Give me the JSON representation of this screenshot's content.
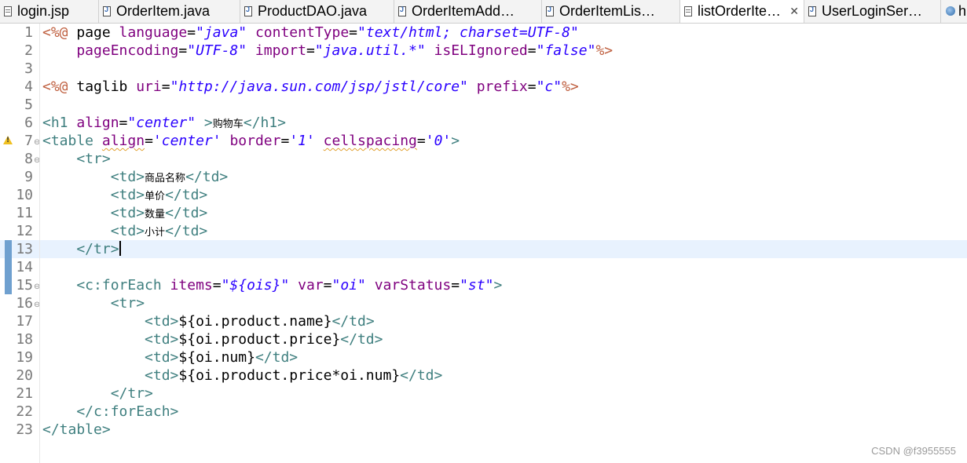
{
  "tabs": [
    {
      "label": "login.jsp",
      "icon": "jsp-file-icon",
      "active": false
    },
    {
      "label": "OrderItem.java",
      "icon": "java-file-icon",
      "active": false
    },
    {
      "label": "ProductDAO.java",
      "icon": "java-file-icon",
      "active": false
    },
    {
      "label": "OrderItemAdd…",
      "icon": "java-file-icon",
      "active": false
    },
    {
      "label": "OrderItemLis…",
      "icon": "java-file-icon",
      "active": false
    },
    {
      "label": "listOrderIte…",
      "icon": "jsp-file-icon",
      "active": true,
      "close": "✕"
    },
    {
      "label": "UserLoginSer…",
      "icon": "java-file-icon",
      "active": false
    },
    {
      "label": "h",
      "icon": "globe-icon",
      "active": false
    }
  ],
  "editor": {
    "line_numbers": [
      "1",
      "2",
      "3",
      "4",
      "5",
      "6",
      "7",
      "8",
      "9",
      "10",
      "11",
      "12",
      "13",
      "14",
      "15",
      "16",
      "17",
      "18",
      "19",
      "20",
      "21",
      "22",
      "23"
    ],
    "code": {
      "l1": {
        "a": "<%@",
        "b": " page ",
        "c": "language",
        "d": "=",
        "e": "\"java\"",
        "f": " contentType",
        "g": "=",
        "h": "\"text/html; charset=UTF-8\""
      },
      "l2": {
        "a": "    pageEncoding",
        "b": "=",
        "c": "\"UTF-8\"",
        "d": " import",
        "e": "=",
        "f": "\"java.util.*\"",
        "g": " isELIgnored",
        "h": "=",
        "i": "\"false\"",
        "j": "%>"
      },
      "l4": {
        "a": "<%@",
        "b": " taglib ",
        "c": "uri",
        "d": "=",
        "e": "\"http://java.sun.com/jsp/jstl/core\"",
        "f": " prefix",
        "g": "=",
        "h": "\"c\"",
        "i": "%>"
      },
      "l6": {
        "a": "<h1",
        "b": " align",
        "c": "=",
        "d": "\"center\"",
        "e": " >",
        "f": "购物车",
        "g": "</h1>"
      },
      "l7": {
        "a": "<table",
        "b": " ",
        "c": "align",
        "d": "=",
        "e": "'center'",
        "f": " border",
        "g": "=",
        "h": "'1'",
        "i": " ",
        "j": "cellspacing",
        "k": "=",
        "l": "'0'",
        "m": ">"
      },
      "l8": {
        "a": "    <tr>"
      },
      "l9": {
        "a": "        <td>",
        "b": "商品名称",
        "c": "</td>"
      },
      "l10": {
        "a": "        <td>",
        "b": "单价",
        "c": "</td>"
      },
      "l11": {
        "a": "        <td>",
        "b": "数量",
        "c": "</td>"
      },
      "l12": {
        "a": "        <td>",
        "b": "小计",
        "c": "</td>"
      },
      "l13": {
        "a": "    </tr>"
      },
      "l15": {
        "a": "    <c:forEach",
        "b": " items",
        "c": "=",
        "d": "\"${ois}\"",
        "e": " var",
        "f": "=",
        "g": "\"oi\"",
        "h": " varStatus",
        "i": "=",
        "j": "\"st\"",
        "k": ">"
      },
      "l16": {
        "a": "        <tr>"
      },
      "l17": {
        "a": "            <td>",
        "b": "${oi.product.name}",
        "c": "</td>"
      },
      "l18": {
        "a": "            <td>",
        "b": "${oi.product.price}",
        "c": "</td>"
      },
      "l19": {
        "a": "            <td>",
        "b": "${oi.num}",
        "c": "</td>"
      },
      "l20": {
        "a": "            <td>",
        "b": "${oi.product.price*oi.num}",
        "c": "</td>"
      },
      "l21": {
        "a": "        </tr>"
      },
      "l22": {
        "a": "    </c:forEach>"
      },
      "l23": {
        "a": "</table>"
      }
    }
  },
  "watermark": "CSDN @f3955555",
  "colors": {
    "tag": "#3f7f7f",
    "directive": "#bf5f3f",
    "attribute": "#7f007f",
    "value": "#2a00ff",
    "current_line": "#e8f2fe",
    "line_number": "#787878"
  }
}
